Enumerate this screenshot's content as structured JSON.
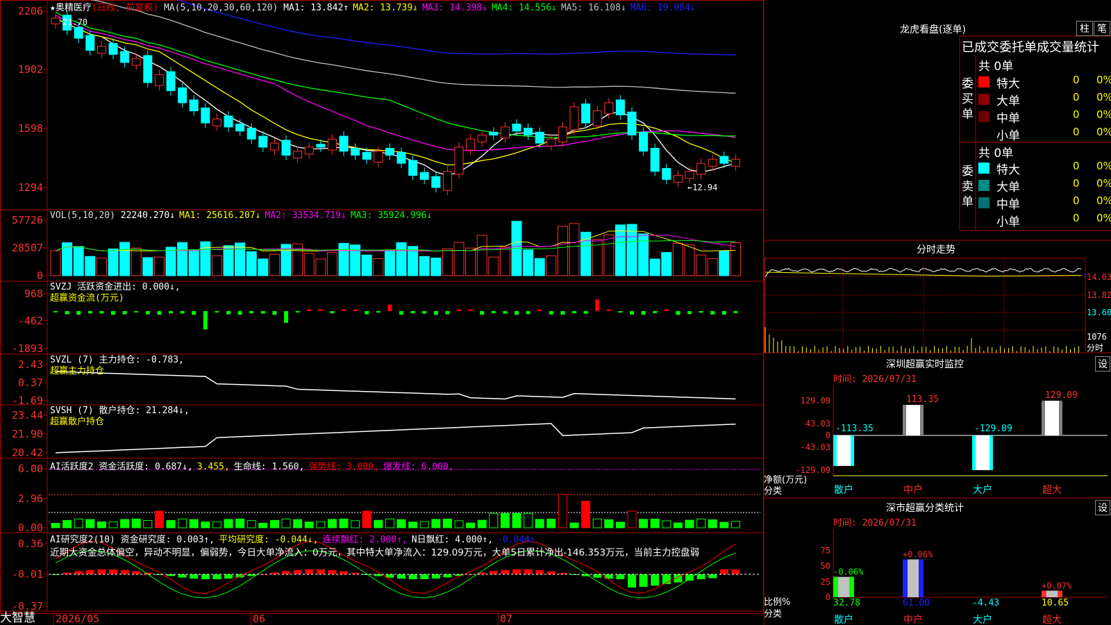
{
  "stock": {
    "name": "★奥精医疗",
    "mode": "(日线, 前复权)",
    "ma_label": "MA(5,10,20,30,60,120)",
    "ma": [
      {
        "t": "MA1: 13.842↑",
        "c": "#ffffff"
      },
      {
        "t": "MA2: 13.739↓",
        "c": "#ffff00"
      },
      {
        "t": "MA3: 14.398↓",
        "c": "#ff00ff"
      },
      {
        "t": "MA4: 14.556↓",
        "c": "#00ff00"
      },
      {
        "t": "MA5: 16.108↓",
        "c": "#c0c0c0"
      },
      {
        "t": "MA6: 19.084↓",
        "c": "#2020ff"
      }
    ],
    "price_axis": [
      "2206",
      "1902",
      "1598",
      "1294"
    ],
    "high_label": "21.70",
    "low_label": "←12.94"
  },
  "vol": {
    "label": "VOL(5,10,20)",
    "items": [
      {
        "t": "22240.270↓",
        "c": "#ffffff"
      },
      {
        "t": "MA1: 25616.207↓",
        "c": "#ffff00"
      },
      {
        "t": "MA2: 33534.719↓",
        "c": "#ff00ff"
      },
      {
        "t": "MA3: 35924.996↓",
        "c": "#00ff00"
      }
    ],
    "axis": [
      "57726",
      "28507",
      "0"
    ]
  },
  "svzj": {
    "line1": "SVZJ  活跃资金进出: 0.000↓,",
    "line2": "超赢资金流(万元)",
    "axis": [
      "968",
      "-462",
      "-1893"
    ]
  },
  "svzl": {
    "line1": "SVZL (7) 主力持仓: -0.783,",
    "line2": "超赢主力持仓",
    "axis": [
      "2.43",
      "0.37",
      "-1.69"
    ]
  },
  "svsh": {
    "line1": "SVSH (7) 散户持仓: 21.284↓,",
    "line2": "超赢散户持仓",
    "axis": [
      "23.44",
      "21.90",
      "20.42"
    ]
  },
  "ai1": {
    "items": [
      {
        "t": "AI活跃度2 资金活跃度: 0.687↓,",
        "c": "#ffffff"
      },
      {
        "t": "3.455,",
        "c": "#ffff00"
      },
      {
        "t": "生命线: 1.560,",
        "c": "#ffffff"
      },
      {
        "t": "强势线: 3.000,",
        "c": "#ff0000"
      },
      {
        "t": "爆发线: 6.000,",
        "c": "#ff00ff"
      }
    ],
    "axis": [
      "6.00",
      "2.96",
      "0.00"
    ]
  },
  "ai2": {
    "items": [
      {
        "t": "AI研究度2(10) 资金研究度: 0.003↑,",
        "c": "#ffffff"
      },
      {
        "t": "平均研究度: -0.044↓,",
        "c": "#ffff00"
      },
      {
        "t": "连续飘红: 2.000↑,",
        "c": "#ff00ff"
      },
      {
        "t": "N日飘红: 4.000↑,",
        "c": "#ffffff"
      },
      {
        "t": "-0.044↑",
        "c": "#2020ff"
      }
    ],
    "comment": "近期大资金总体偏空，异动不明显，偏弱势，今日大单净流入：0万元，其中特大单净流入：129.09万元，大单5日累计净出-146.353万元，当前主力控盘弱",
    "axis": [
      "0.36",
      "-0.01",
      "-0.37"
    ]
  },
  "date_axis": [
    "2026/05",
    "06",
    "07"
  ],
  "brand": "大智慧",
  "right": {
    "dragon_title": "龙虎看盘(逐单)",
    "tab1": "柱",
    "tab2": "笔",
    "stats_title": "已成交委托单成交量统计",
    "buy_label": "委买单",
    "sell_label": "委卖单",
    "buy_total": "共 0单",
    "sell_total": "共 0单",
    "buy_rows": [
      {
        "name": "特大",
        "n": "0",
        "p": "0%",
        "c": "#ff0000"
      },
      {
        "name": "大单",
        "n": "0",
        "p": "0%",
        "c": "#8b0000"
      },
      {
        "name": "中单",
        "n": "0",
        "p": "0%",
        "c": "#6b0000"
      },
      {
        "name": "小单",
        "n": "0",
        "p": "0%",
        "c": ""
      }
    ],
    "sell_rows": [
      {
        "name": "特大",
        "n": "0",
        "p": "0%",
        "c": "#00ffff"
      },
      {
        "name": "大单",
        "n": "0",
        "p": "0%",
        "c": "#008b8b"
      },
      {
        "name": "中单",
        "n": "0",
        "p": "0%",
        "c": "#007070"
      },
      {
        "name": "小单",
        "n": "0",
        "p": "0%",
        "c": ""
      }
    ],
    "intraday_title": "分时走势",
    "intraday_axis": [
      "14.03",
      "13.82",
      "13.60",
      "1076",
      "分时"
    ],
    "monitor_title": "深圳超赢实时监控",
    "monitor_time": "时间: 2026/07/31",
    "monitor_btn": "设",
    "monitor_axis": [
      "129.09",
      "43.03",
      "0",
      "-43.03",
      "-129.09"
    ],
    "monitor_bars": [
      {
        "label": "-113.35",
        "value": -113.35
      },
      {
        "label": "113.35",
        "value": 113.35
      },
      {
        "label": "-129.09",
        "value": -129.09
      },
      {
        "label": "129.09",
        "value": 129.09
      }
    ],
    "monitor_net": "净额(万元)",
    "monitor_cls": "分类",
    "cats": [
      "散户",
      "中户",
      "大户",
      "超大"
    ],
    "class_title": "深市超赢分类统计",
    "class_time": "时间: 2026/07/31",
    "class_btn": "设",
    "class_axis": [
      "75",
      "50",
      "25",
      "0"
    ],
    "class_bars": [
      {
        "pct": "-0.06%",
        "value": 32.78,
        "label": "32.78",
        "lc": "#00ff00"
      },
      {
        "pct": "+0.06%",
        "value": 61.0,
        "label": "61.00",
        "lc": "#2020ff"
      },
      {
        "pct": "",
        "value": -4.43,
        "label": "-4.43",
        "lc": "#00ffff"
      },
      {
        "pct": "+0.07%",
        "value": 10.65,
        "label": "10.65",
        "lc": "#ffff00"
      }
    ],
    "class_ratio": "比例%",
    "class_cls": "分类"
  }
}
